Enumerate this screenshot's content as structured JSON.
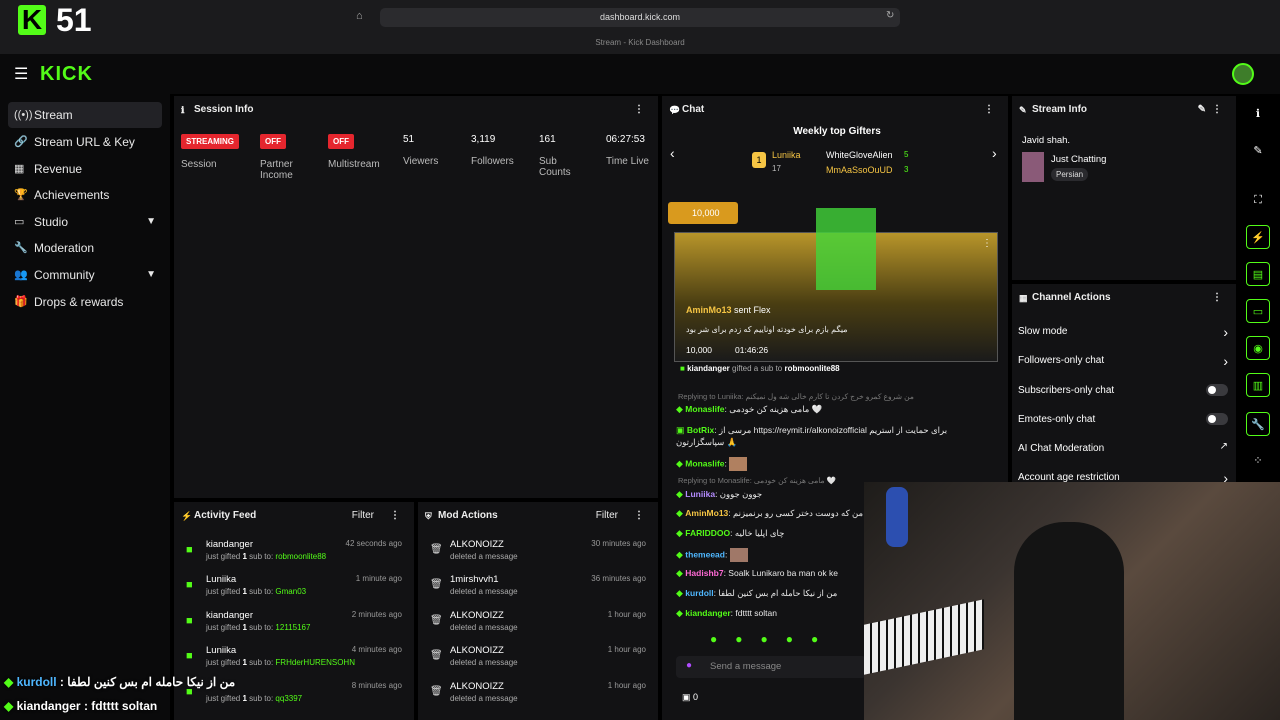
{
  "browser": {
    "url": "dashboard.kick.com",
    "tab_title": "Stream - Kick Dashboard"
  },
  "overlay": {
    "viewer_count": "51"
  },
  "header": {
    "logo": "KICK"
  },
  "sidebar": {
    "items": [
      {
        "label": "Stream",
        "icon": "antenna-icon",
        "active": true
      },
      {
        "label": "Stream URL & Key",
        "icon": "link-icon"
      },
      {
        "label": "Revenue",
        "icon": "chart-icon"
      },
      {
        "label": "Achievements",
        "icon": "trophy-icon"
      },
      {
        "label": "Studio",
        "icon": "monitor-icon",
        "expand": true
      },
      {
        "label": "Moderation",
        "icon": "wrench-icon"
      },
      {
        "label": "Community",
        "icon": "people-icon",
        "expand": true
      },
      {
        "label": "Drops & rewards",
        "icon": "gift-icon"
      }
    ]
  },
  "session": {
    "title": "Session Info",
    "stats": [
      {
        "badge": "STREAMING",
        "label": "Session"
      },
      {
        "badge": "OFF",
        "label": "Partner Income"
      },
      {
        "badge": "OFF",
        "label": "Multistream"
      },
      {
        "value": "51",
        "label": "Viewers"
      },
      {
        "value": "3,119",
        "label": "Followers"
      },
      {
        "value": "161",
        "label": "Sub Counts"
      },
      {
        "value": "06:27:53",
        "label": "Time Live"
      }
    ]
  },
  "activity": {
    "title": "Activity Feed",
    "filter": "Filter",
    "rows": [
      {
        "name": "kiandanger",
        "pre": "just gifted",
        "num": "1",
        "mid": "sub to:",
        "target": "robmoonlite88",
        "time": "42 seconds ago"
      },
      {
        "name": "Luniika",
        "pre": "just gifted",
        "num": "1",
        "mid": "sub to:",
        "target": "Gman03",
        "time": "1 minute ago"
      },
      {
        "name": "kiandanger",
        "pre": "just gifted",
        "num": "1",
        "mid": "sub to:",
        "target": "12115167",
        "time": "2 minutes ago"
      },
      {
        "name": "Luniika",
        "pre": "just gifted",
        "num": "1",
        "mid": "sub to:",
        "target": "FRHderHURENSOHN",
        "time": "4 minutes ago"
      },
      {
        "name": "",
        "pre": "just gifted",
        "num": "1",
        "mid": "sub to:",
        "target": "qq3397",
        "time": "8 minutes ago"
      }
    ]
  },
  "mod": {
    "title": "Mod Actions",
    "filter": "Filter",
    "rows": [
      {
        "name": "ALKONOIZZ",
        "action": "deleted a message",
        "time": "30 minutes ago"
      },
      {
        "name": "1mirshvvh1",
        "action": "deleted a message",
        "time": "36 minutes ago"
      },
      {
        "name": "ALKONOIZZ",
        "action": "deleted a message",
        "time": "1 hour ago"
      },
      {
        "name": "ALKONOIZZ",
        "action": "deleted a message",
        "time": "1 hour ago"
      },
      {
        "name": "ALKONOIZZ",
        "action": "deleted a message",
        "time": "1 hour ago"
      }
    ]
  },
  "chat": {
    "title": "Chat",
    "gifters_title": "Weekly top Gifters",
    "gifters": [
      {
        "name": "Luniika",
        "count": "17"
      },
      {
        "name": "WhiteGloveAlien",
        "count": "5"
      },
      {
        "name": "MmAaSsoOuUD",
        "count": "3"
      }
    ],
    "pinned_amount": "10,000",
    "flex": {
      "user": "AminMo13",
      "action": "sent Flex",
      "message": "میگم بازم برای خودته اوناییم که زدم برای شر بود",
      "amount": "10,000",
      "timer": "01:46:26"
    },
    "gift_line": {
      "user": "kiandanger",
      "mid": "gifted a sub to",
      "target": "robmoonlite88"
    },
    "messages": [
      {
        "reply": "Replying to Luniika: من شروع کمرو خرج کردن تا کارم خالی شه ول نمیکنم"
      },
      {
        "user": "Monaslife",
        "text": "مامی هزینه کن خودمی 🤍",
        "color": "#53fc18"
      },
      {
        "user": "BotRix",
        "text": "مرسی از https://reymit.ir/alkonoizofficial برای حمایت از استریم سپاسگزارتون 🙏",
        "color": "#53fc18"
      },
      {
        "user": "Monaslife",
        "text": "",
        "color": "#53fc18"
      },
      {
        "reply": "Replying to Monaslife: مامی هزینه کن خودمی 🤍"
      },
      {
        "user": "Luniika",
        "text": "جوون جوون",
        "color": "#b48cff"
      },
      {
        "user": "AminMo13",
        "text": "تشه من که دوست دختر کسی رو برنمیزنم",
        "color": "#f6c544"
      },
      {
        "user": "FARIDDOO",
        "text": "چای اپلیا خالیه",
        "color": "#53fc18"
      },
      {
        "user": "themeead",
        "text": "",
        "color": "#4fb7ff"
      },
      {
        "user": "Hadishb7",
        "text": "Soalk Lunikaro ba man ok ke",
        "color": "#ff6ad5"
      },
      {
        "user": "kurdoll",
        "text": "من از نیکا حامله ام بس کنین لطفا",
        "color": "#4fb7ff"
      },
      {
        "user": "kiandanger",
        "text": "fdtttt soltan",
        "color": "#53fc18"
      }
    ],
    "input_placeholder": "Send a message",
    "input_count": "0"
  },
  "stream_info": {
    "title": "Stream Info",
    "streamer": "Javid shah.",
    "category": "Just Chatting",
    "tag": "Persian"
  },
  "channel_actions": {
    "title": "Channel Actions",
    "items": [
      {
        "label": "Slow mode",
        "type": "chevron"
      },
      {
        "label": "Followers-only chat",
        "type": "chevron"
      },
      {
        "label": "Subscribers-only chat",
        "type": "toggle",
        "on": false
      },
      {
        "label": "Emotes-only chat",
        "type": "toggle",
        "on": false
      },
      {
        "label": "AI Chat Moderation",
        "type": "external"
      },
      {
        "label": "Account age restriction",
        "type": "chevron"
      }
    ]
  },
  "overlay_chat": [
    {
      "user": "kurdoll",
      "text": "من از نیکا حامله ام بس کنین لطفا"
    },
    {
      "user": "kiandanger",
      "text": "fdtttt soltan"
    }
  ],
  "colors": {
    "accent": "#53fc18",
    "live": "#e5262e",
    "panel": "#121214"
  }
}
